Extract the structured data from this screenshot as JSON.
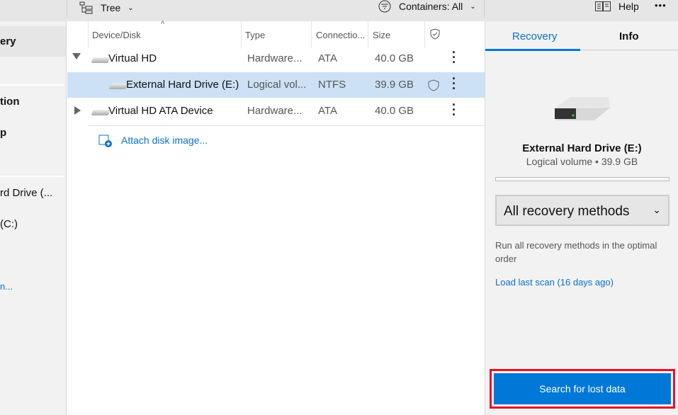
{
  "toolbar": {
    "view_label": "Tree",
    "filter_label": "Containers: All",
    "help_label": "Help",
    "more_label": "•••"
  },
  "sidebar": {
    "items": [
      {
        "label": "ery",
        "selected": true
      },
      {
        "label": "tion"
      },
      {
        "label": "p"
      },
      {
        "label": "rd Drive (..."
      },
      {
        "label": "(C:)"
      },
      {
        "label": "n...",
        "link": true
      }
    ]
  },
  "table": {
    "columns": [
      "Device/Disk",
      "Type",
      "Connectio...",
      "Size"
    ],
    "rows": [
      {
        "name": "Virtual HD",
        "type": "Hardware...",
        "connection": "ATA",
        "size": "40.0 GB",
        "expanded": true
      },
      {
        "name": "External Hard Drive (E:)",
        "type": "Logical vol...",
        "connection": "NTFS",
        "size": "39.9 GB",
        "selected": true,
        "protected": true
      },
      {
        "name": "Virtual HD ATA Device",
        "type": "Hardware...",
        "connection": "ATA",
        "size": "40.0 GB",
        "expanded": false
      }
    ],
    "attach_label": "Attach disk image..."
  },
  "panel": {
    "tabs": [
      {
        "label": "Recovery",
        "active": true
      },
      {
        "label": "Info"
      }
    ],
    "drive_name": "External Hard Drive (E:)",
    "drive_details": "Logical volume • 39.9 GB",
    "progress": 0,
    "method_select": "All recovery methods",
    "method_description": "Run all recovery methods in the optimal order",
    "load_scan_label": "Load last scan (16 days ago)",
    "search_button": "Search for lost data"
  },
  "colors": {
    "accent": "#0078d7",
    "selection": "#cce1f5",
    "highlight_box": "#e81123"
  }
}
